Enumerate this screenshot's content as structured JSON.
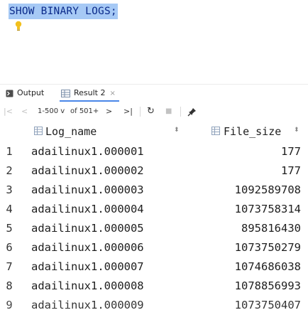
{
  "editor": {
    "sql_keyword": "SHOW BINARY LOGS",
    "sql_terminator": ";"
  },
  "tabs": {
    "output_label": "Output",
    "result_label": "Result 2",
    "close_glyph": "×"
  },
  "toolbar": {
    "first_glyph": "|<",
    "prev_glyph": "<",
    "range_label": "1-500",
    "range_chevron": "v",
    "of_label": "of 501+",
    "next_glyph": ">",
    "last_glyph": ">|",
    "refresh_glyph": "↻",
    "stop_glyph": "■",
    "pin_glyph": "📌"
  },
  "grid": {
    "columns": [
      "Log_name",
      "File_size"
    ],
    "sort_glyph": "⬍",
    "rows": [
      {
        "num": "1",
        "name": "adailinux1.000001",
        "size": "177"
      },
      {
        "num": "2",
        "name": "adailinux1.000002",
        "size": "177"
      },
      {
        "num": "3",
        "name": "adailinux1.000003",
        "size": "1092589708"
      },
      {
        "num": "4",
        "name": "adailinux1.000004",
        "size": "1073758314"
      },
      {
        "num": "5",
        "name": "adailinux1.000005",
        "size": "895816430"
      },
      {
        "num": "6",
        "name": "adailinux1.000006",
        "size": "1073750279"
      },
      {
        "num": "7",
        "name": "adailinux1.000007",
        "size": "1074686038"
      },
      {
        "num": "8",
        "name": "adailinux1.000008",
        "size": "1078856993"
      },
      {
        "num": "9",
        "name": "adailinux1.000009",
        "size": "1073750407"
      }
    ]
  },
  "colors": {
    "selection": "#a6c9f5",
    "keyword": "#0b2a8a",
    "accent": "#4a86e8"
  }
}
